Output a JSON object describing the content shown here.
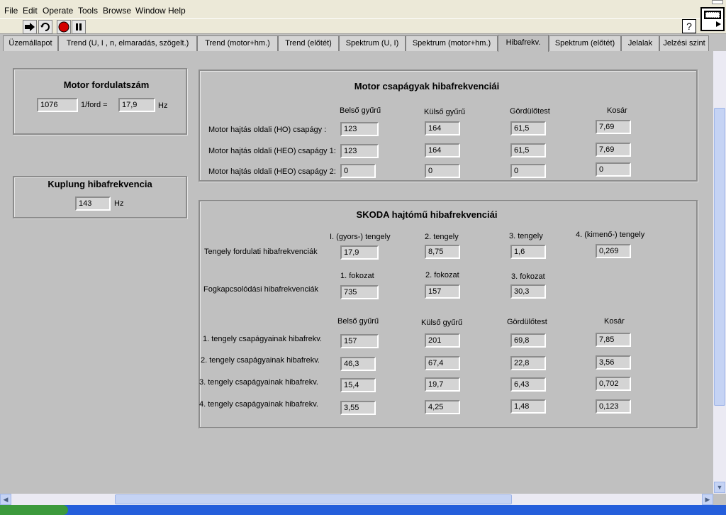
{
  "menu": [
    "File",
    "Edit",
    "Operate",
    "Tools",
    "Browse",
    "Window",
    "Help"
  ],
  "help_label": "?",
  "tabs": [
    "Üzemállapot",
    "Trend (U, I , n, elmaradás, szögelt.)",
    "Trend (motor+hm.)",
    "Trend (előtét)",
    "Spektrum (U, I)",
    "Spektrum (motor+hm.)",
    "Hibafrekv.",
    "Spektrum (előtét)",
    "Jelalak",
    "Jelzési szint"
  ],
  "motor_speed": {
    "title": "Motor fordulatszám",
    "rpm": "1076",
    "ford_label": "1/ford =",
    "hz_value": "17,9",
    "unit": "Hz"
  },
  "coupling": {
    "title": "Kuplung hibafrekvencia",
    "value": "143",
    "unit": "Hz"
  },
  "bearings": {
    "title": "Motor csapágyak hibafrekvenciái",
    "columns": [
      "Belső gyűrű",
      "Külső gyűrű",
      "Gördülőtest",
      "Kosár"
    ],
    "rows": [
      {
        "label": "Motor hajtás oldali (HO) csapágy :",
        "values": [
          "123",
          "164",
          "61,5",
          "7,69"
        ]
      },
      {
        "label": "Motor hajtás oldali (HEO) csapágy 1:",
        "values": [
          "123",
          "164",
          "61,5",
          "7,69"
        ]
      },
      {
        "label": "Motor hajtás oldali (HEO) csapágy 2:",
        "values": [
          "0",
          "0",
          "0",
          "0"
        ]
      }
    ]
  },
  "gearbox": {
    "title": "SKODA hajtómű hibafrekvenciái",
    "shaft_columns": [
      "I. (gyors-) tengely",
      "2. tengely",
      "3. tengely",
      "4. (kimenő-) tengely"
    ],
    "shaft_row": {
      "label": "Tengely fordulati hibafrekvenciák",
      "values": [
        "17,9",
        "8,75",
        "1,6",
        "0,269"
      ]
    },
    "gear_columns": [
      "1. fokozat",
      "2. fokozat",
      "3. fokozat"
    ],
    "gear_row": {
      "label": "Fogkapcsolódási hibafrekvenciák",
      "values": [
        "735",
        "157",
        "30,3"
      ]
    },
    "bearing_columns": [
      "Belső gyűrű",
      "Külső gyűrű",
      "Gördülőtest",
      "Kosár"
    ],
    "bearing_rows": [
      {
        "label": "1. tengely csapágyainak hibafrekv.",
        "values": [
          "157",
          "201",
          "69,8",
          "7,85"
        ]
      },
      {
        "label": "2. tengely csapágyainak hibafrekv.",
        "values": [
          "46,3",
          "67,4",
          "22,8",
          "3,56"
        ]
      },
      {
        "label": "3. tengely csapágyainak hibafrekv.",
        "values": [
          "15,4",
          "19,7",
          "6,43",
          "0,702"
        ]
      },
      {
        "label": "4. tengely csapágyainak hibafrekv.",
        "values": [
          "3,55",
          "4,25",
          "1,48",
          "0,123"
        ]
      }
    ]
  },
  "colors": {
    "background": "#c0c0c0",
    "run_stop": "#d40000"
  }
}
